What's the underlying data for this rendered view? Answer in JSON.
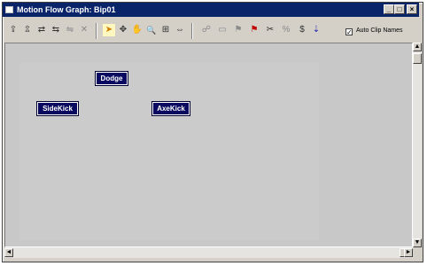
{
  "window": {
    "title": "Motion Flow Graph: Bip01",
    "controls": {
      "minimize": "_",
      "maximize": "□",
      "close": "×"
    }
  },
  "toolbar": {
    "buttons": [
      {
        "name": "create-clip-icon",
        "glyph": "⇪"
      },
      {
        "name": "create-multiple-clips-icon",
        "glyph": "⇫"
      },
      {
        "name": "create-transition-icon",
        "glyph": "⇄"
      },
      {
        "name": "create-transitions-icon",
        "glyph": "⇆"
      },
      {
        "name": "create-random-transition-icon",
        "glyph": "⇋"
      },
      {
        "name": "delete-icon",
        "glyph": "✕"
      },
      {
        "name": "select-arrow-icon",
        "glyph": "➤"
      },
      {
        "name": "move-icon",
        "glyph": "✥"
      },
      {
        "name": "pan-hand-icon",
        "glyph": "✋"
      },
      {
        "name": "zoom-icon",
        "glyph": "🔍"
      },
      {
        "name": "zoom-region-icon",
        "glyph": "⊞"
      },
      {
        "name": "zoom-extents-icon",
        "glyph": "⇔"
      },
      {
        "name": "show-random-icon",
        "glyph": "☍"
      },
      {
        "name": "optimize-icon",
        "glyph": "▭"
      },
      {
        "name": "set-start-icon",
        "glyph": "⚑"
      },
      {
        "name": "red-flag-icon",
        "glyph": "⚑"
      },
      {
        "name": "cut-icon",
        "glyph": "✂"
      },
      {
        "name": "percent-icon",
        "glyph": "%"
      },
      {
        "name": "dollar-icon",
        "glyph": "$"
      },
      {
        "name": "transition-info-icon",
        "glyph": "⇣"
      }
    ],
    "auto_clip_names": {
      "label": "Auto Clip Names",
      "checked": true,
      "check_glyph": "✓"
    }
  },
  "graph": {
    "nodes": [
      {
        "label": "Dodge"
      },
      {
        "label": "SideKick"
      },
      {
        "label": "AxeKick"
      }
    ]
  },
  "scrollbars": {
    "up": "▲",
    "down": "▼",
    "left": "◄",
    "right": "►"
  }
}
